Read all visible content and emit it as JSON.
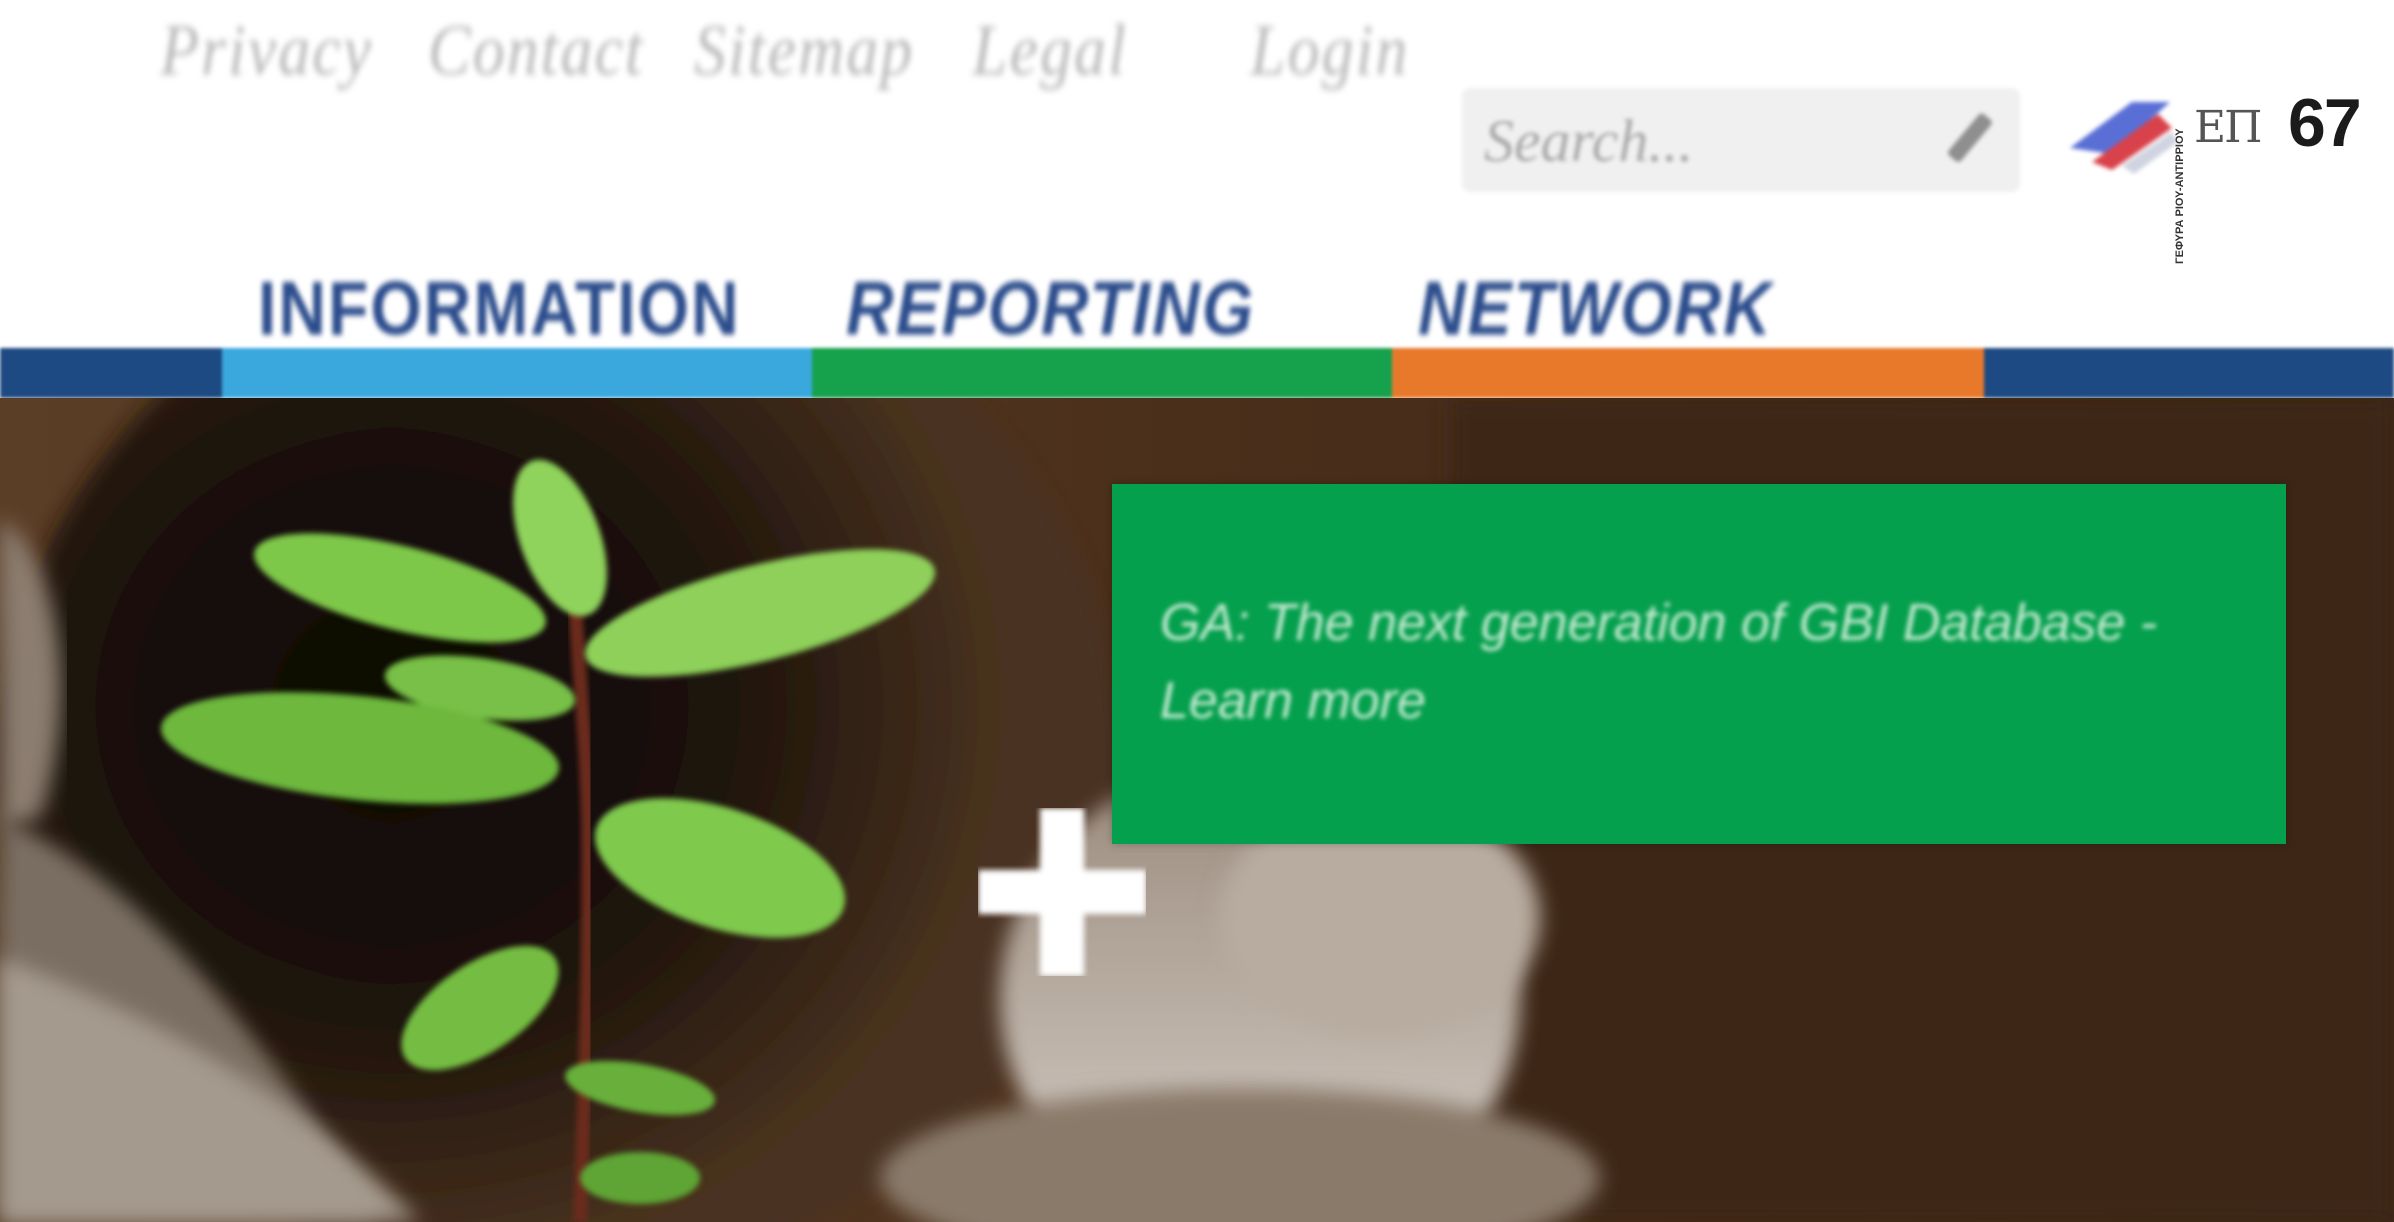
{
  "utility_links": [
    "Privacy",
    "Contact",
    "Sitemap",
    "Legal",
    "Login"
  ],
  "search": {
    "placeholder": "Search...",
    "button_icon": "pencil-search-icon"
  },
  "language_icon": "flag-icon",
  "logo": {
    "prefix": "ΕΠ",
    "number": "67",
    "caption": "ΓΕΦΥΡΑ ΡΙΟΥ-ΑΝΤΙΡΡΙΟΥ"
  },
  "main_nav": [
    "INFORMATION",
    "REPORTING",
    "NETWORK"
  ],
  "band_colors": {
    "dark_blue": "#1d4a82",
    "light_blue": "#3aa8dd",
    "green": "#16a14c",
    "orange": "#e8792b"
  },
  "hero": {
    "promo_text": "GA: The next generation of GBI Database - Learn more",
    "promo_color": "#05a04e",
    "plus_icon": "plus-icon"
  }
}
